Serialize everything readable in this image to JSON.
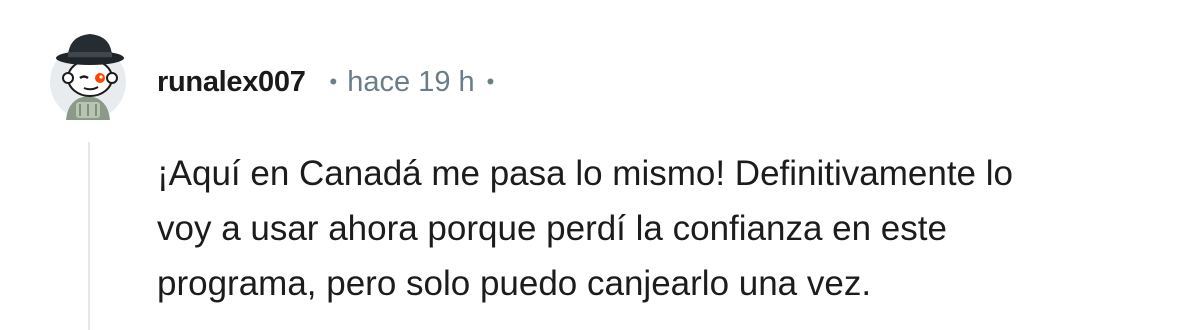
{
  "comment": {
    "author": "runalex007",
    "separator": "•",
    "time": "hace 19 h",
    "avatar_icon": "snoo-avatar-icon",
    "text_lines": [
      "¡Aquí en Canadá me pasa lo mismo! Definitivamente lo",
      "voy a usar ahora porque perdí la confianza en este",
      "programa, pero solo puedo canjearlo una vez."
    ]
  }
}
